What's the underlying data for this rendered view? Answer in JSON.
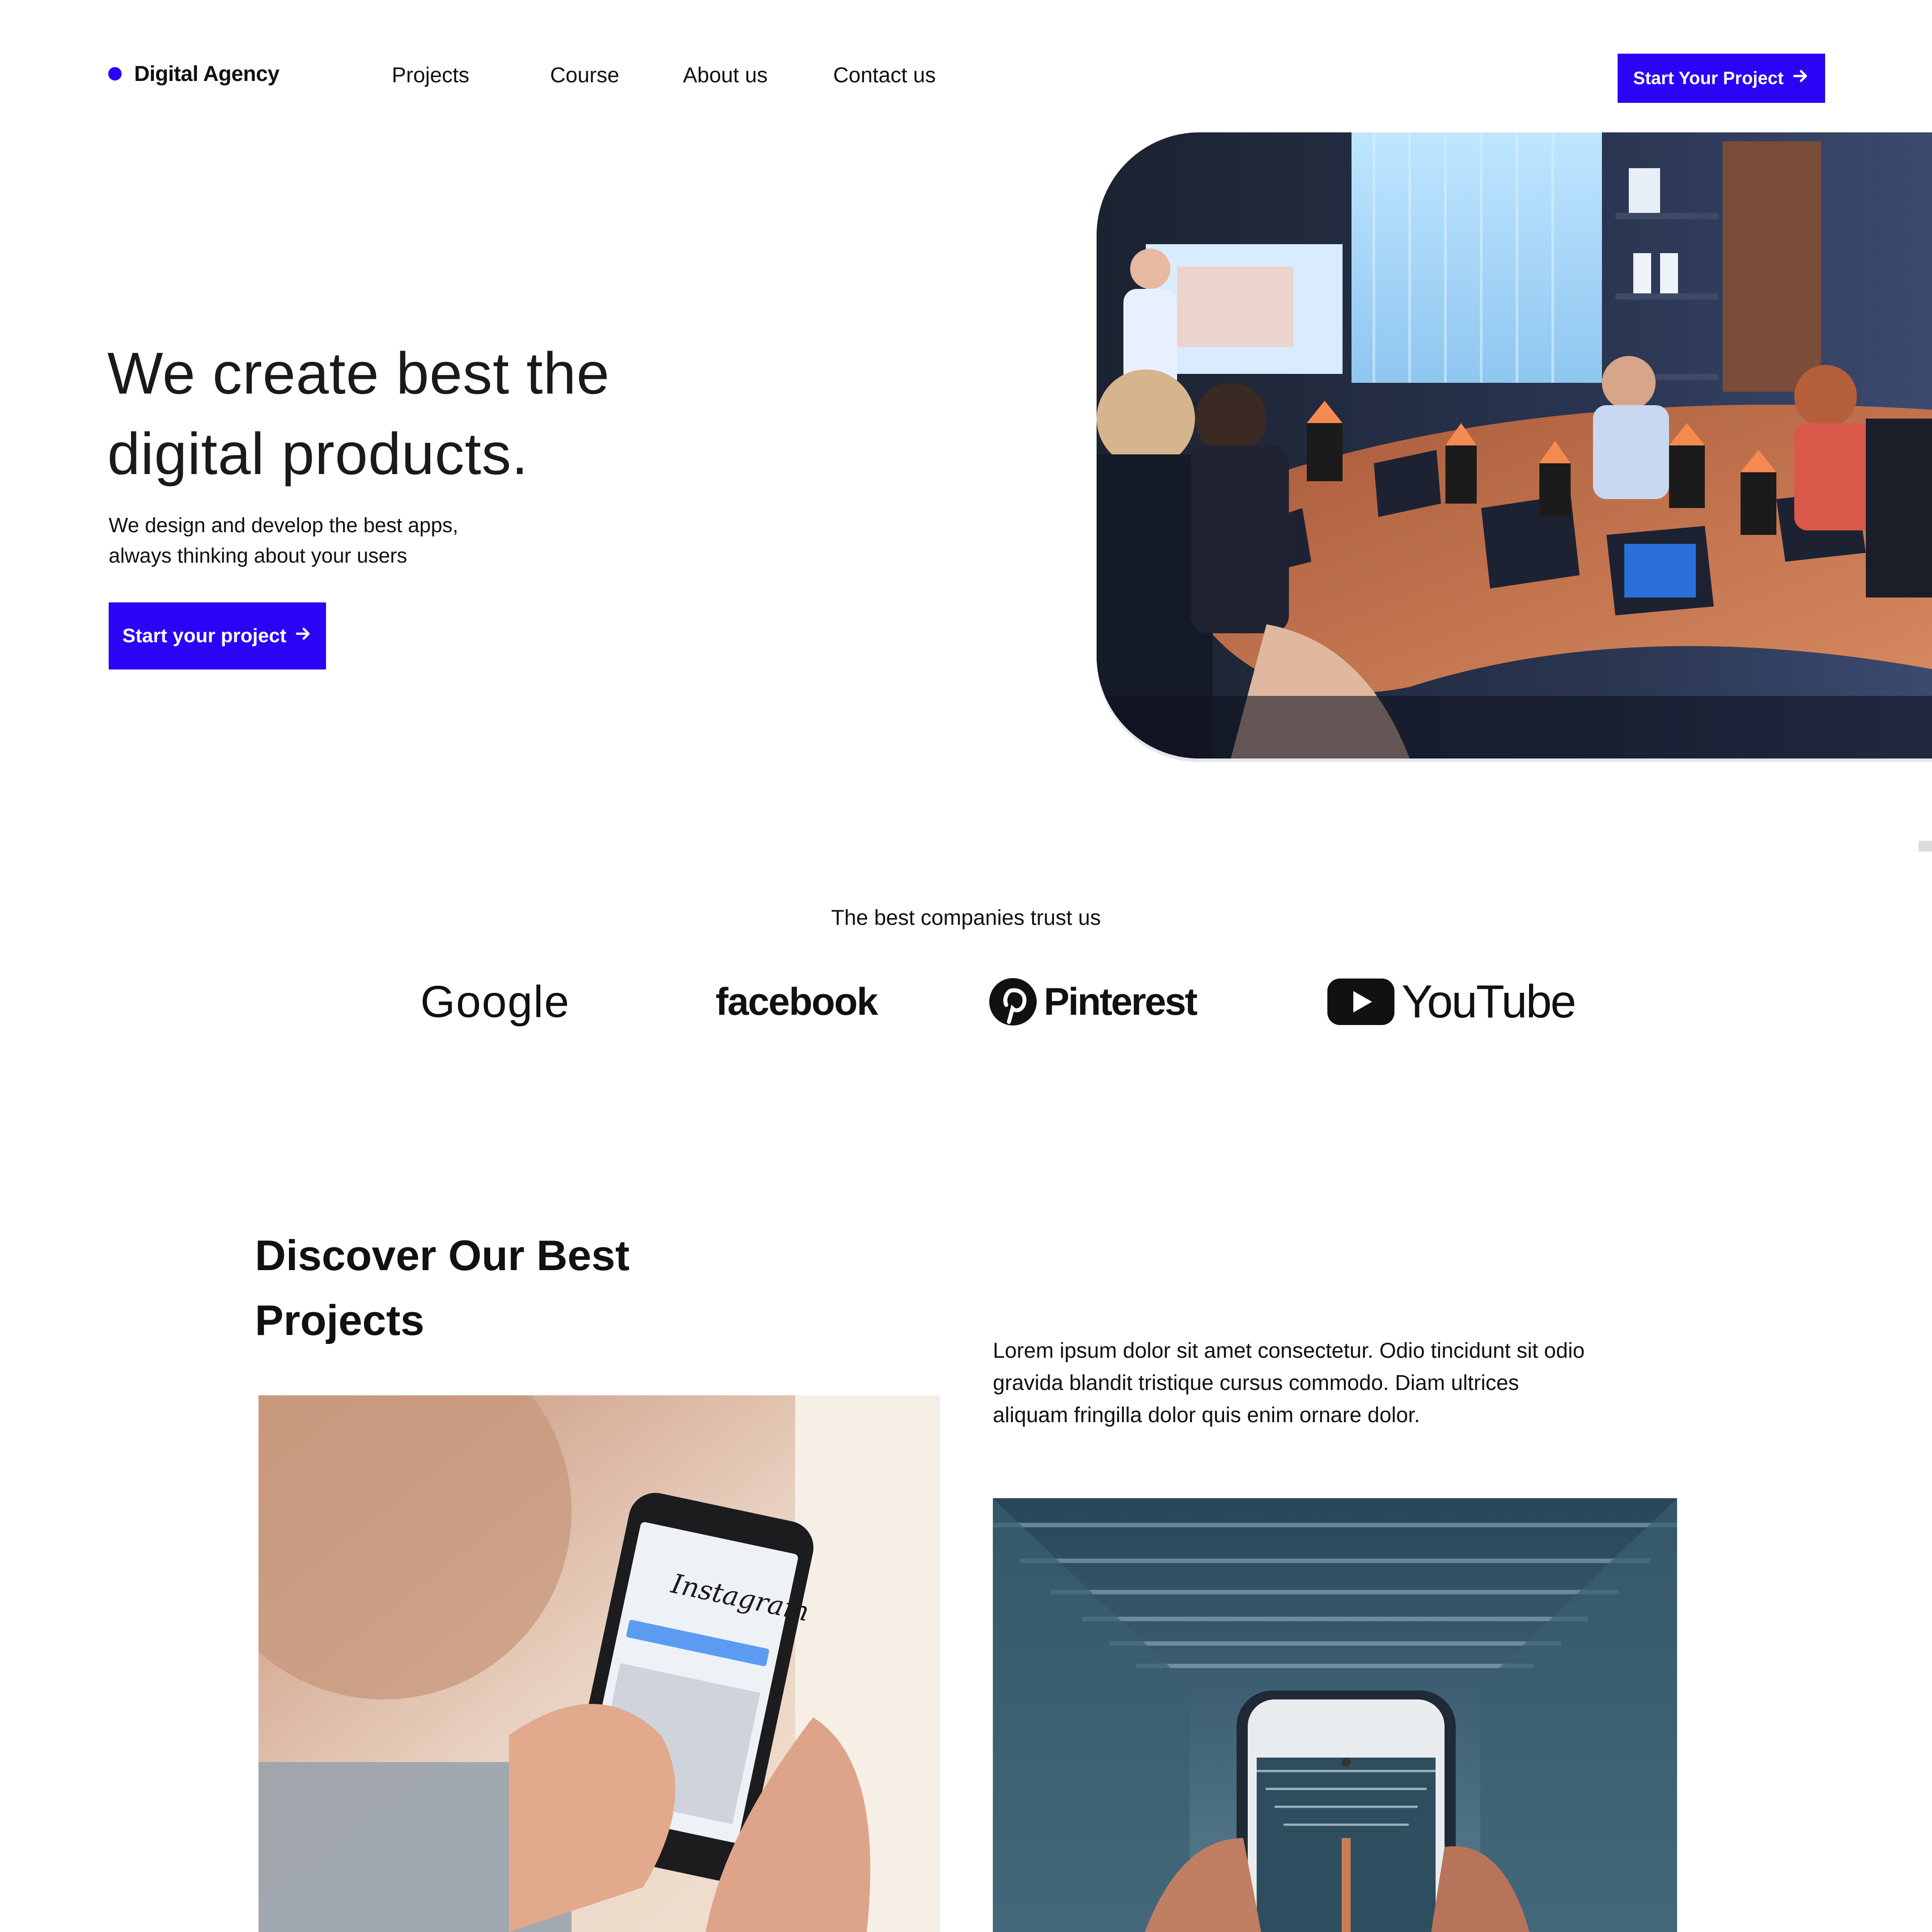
{
  "brand": {
    "name": "Digital Agency",
    "accent": "#2a05f5"
  },
  "nav": {
    "links": [
      "Projects",
      "Course",
      "About us",
      "Contact us"
    ],
    "cta_label": "Start Your Project",
    "cta_icon": "arrow-right-icon"
  },
  "hero": {
    "title_lines": [
      "We create best the",
      "digital products."
    ],
    "subtitle_lines": [
      "We design and develop the best apps,",
      "always thinking about your users"
    ],
    "cta_label": "Start your project",
    "image": "meeting-room-photo"
  },
  "trust": {
    "title": "The best companies trust us",
    "logos": [
      "Google",
      "facebook",
      "Pinterest",
      "YouTube"
    ]
  },
  "projects": {
    "title_lines": [
      "Discover Our Best",
      "Projects"
    ],
    "description_lines": [
      "Lorem ipsum dolor sit amet consectetur. Odio tincidunt sit odio",
      "gravida blandit tristique cursus commodo. Diam ultrices",
      "aliquam fringilla dolor quis enim ornare dolor."
    ],
    "images": [
      "instagram-phone-photo",
      "phone-camera-corridor-photo"
    ]
  }
}
